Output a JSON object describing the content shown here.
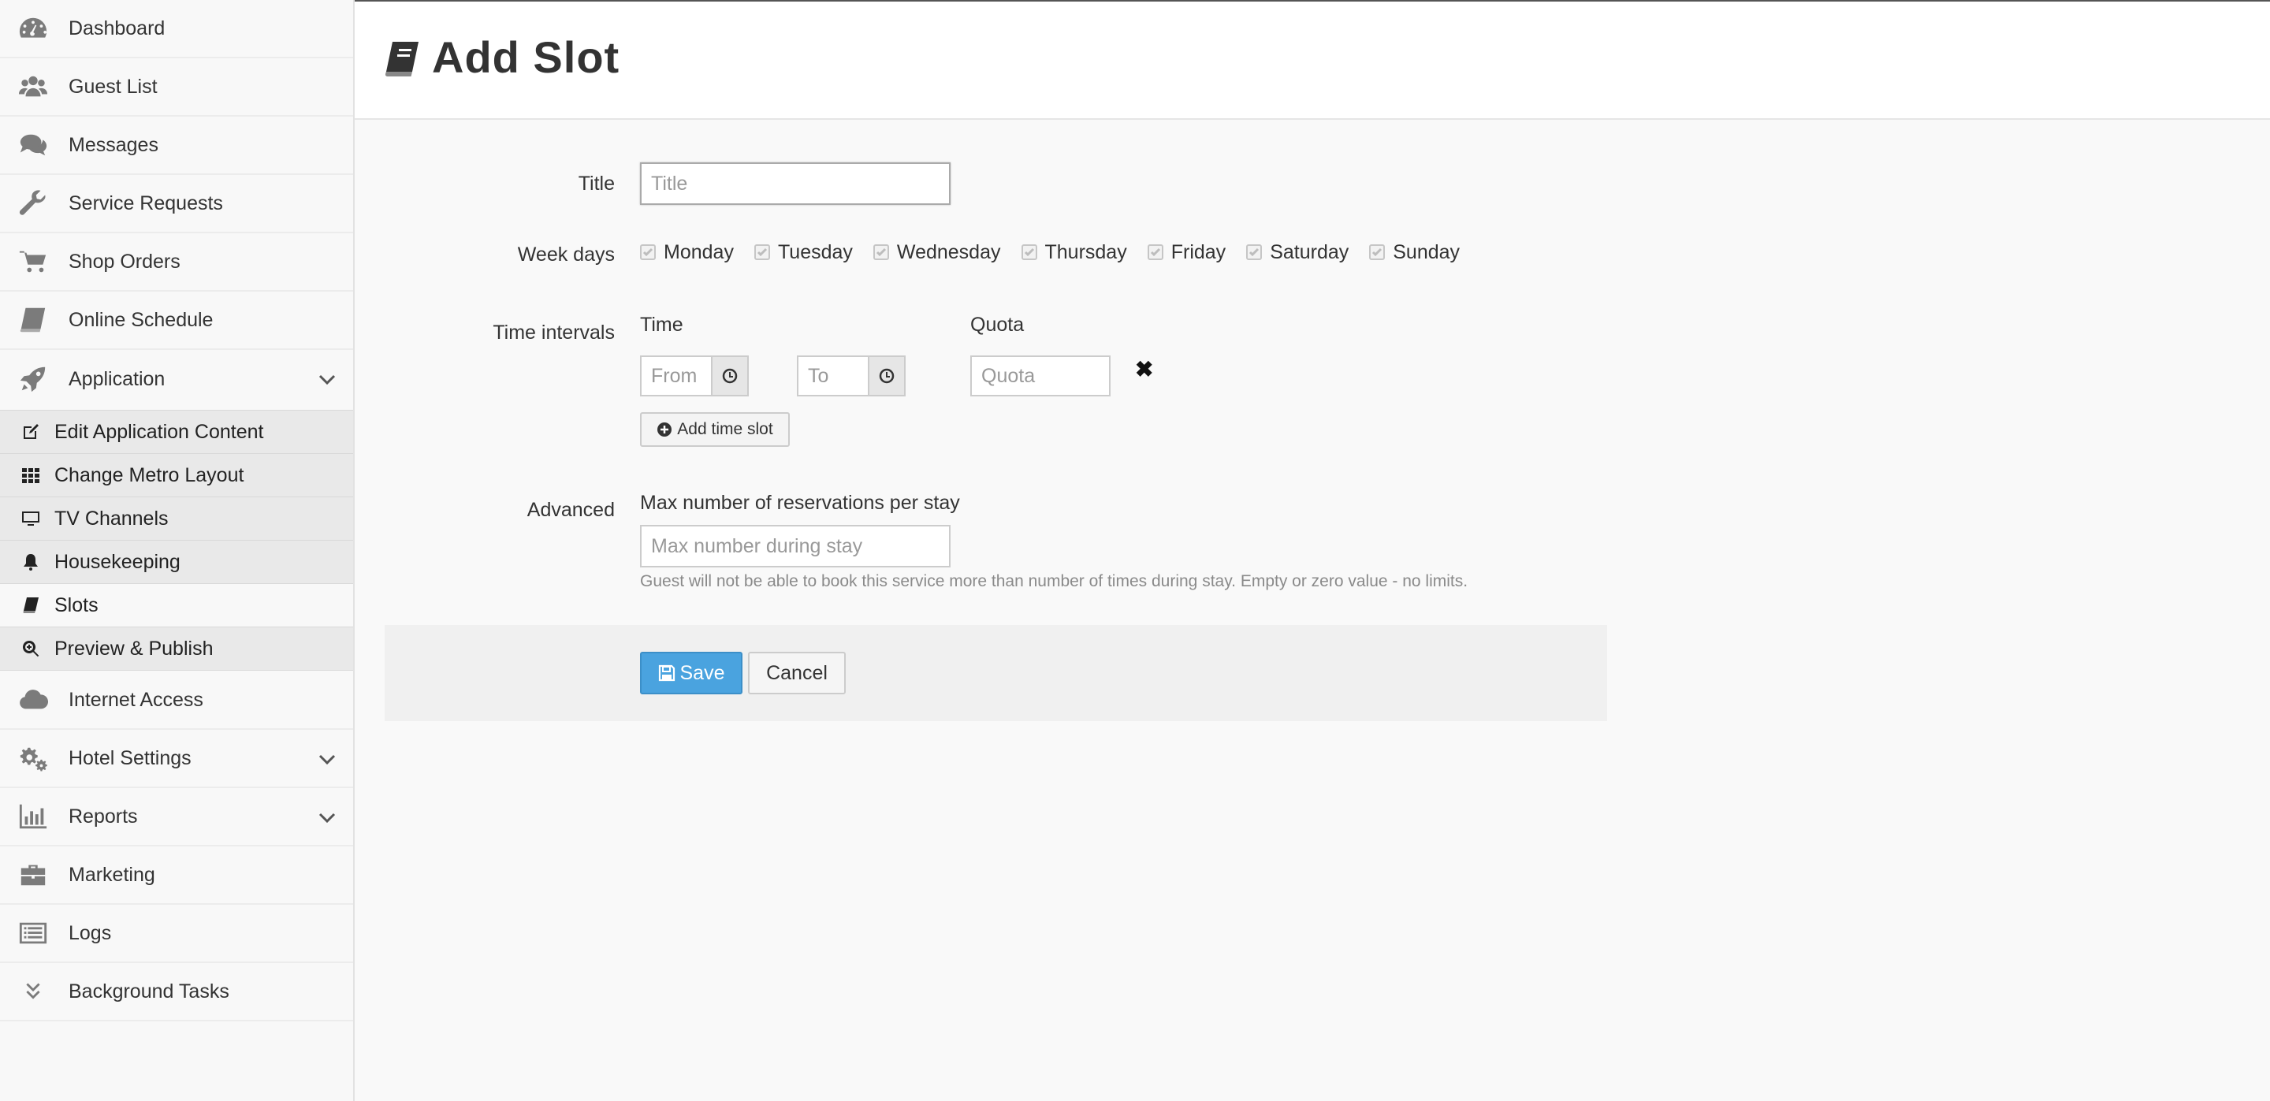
{
  "sidebar": {
    "items": [
      {
        "label": "Dashboard",
        "icon": "dashboard-icon"
      },
      {
        "label": "Guest List",
        "icon": "users-icon"
      },
      {
        "label": "Messages",
        "icon": "comments-icon"
      },
      {
        "label": "Service Requests",
        "icon": "wrench-icon"
      },
      {
        "label": "Shop Orders",
        "icon": "cart-icon"
      },
      {
        "label": "Online Schedule",
        "icon": "book-icon"
      },
      {
        "label": "Application",
        "icon": "rocket-icon"
      }
    ],
    "subitems": [
      {
        "label": "Edit Application Content",
        "icon": "edit-icon"
      },
      {
        "label": "Change Metro Layout",
        "icon": "grid-icon"
      },
      {
        "label": "TV Channels",
        "icon": "monitor-icon"
      },
      {
        "label": "Housekeeping",
        "icon": "bell-icon"
      },
      {
        "label": "Slots",
        "icon": "book-icon"
      },
      {
        "label": "Preview & Publish",
        "icon": "search-plus-icon"
      }
    ],
    "items2": [
      {
        "label": "Internet Access",
        "icon": "cloud-icon"
      },
      {
        "label": "Hotel Settings",
        "icon": "cogs-icon"
      },
      {
        "label": "Reports",
        "icon": "bar-chart-icon"
      },
      {
        "label": "Marketing",
        "icon": "briefcase-icon"
      },
      {
        "label": "Logs",
        "icon": "list-icon"
      },
      {
        "label": "Background Tasks",
        "icon": "double-chevron-down-icon"
      }
    ]
  },
  "header": {
    "title": "Add Slot"
  },
  "form": {
    "title_label": "Title",
    "title_placeholder": "Title",
    "weekdays_label": "Week days",
    "weekdays": [
      "Monday",
      "Tuesday",
      "Wednesday",
      "Thursday",
      "Friday",
      "Saturday",
      "Sunday"
    ],
    "time_intervals_label": "Time intervals",
    "time_col_label": "Time",
    "quota_col_label": "Quota",
    "from_placeholder": "From",
    "to_placeholder": "To",
    "quota_placeholder": "Quota",
    "remove_symbol": "✖",
    "add_time_slot": "Add time slot",
    "advanced_label": "Advanced",
    "max_label": "Max number of reservations per stay",
    "max_placeholder": "Max number during stay",
    "max_help": "Guest will not be able to book this service more than number of times during stay. Empty or zero value - no limits."
  },
  "actions": {
    "save": "Save",
    "cancel": "Cancel"
  }
}
